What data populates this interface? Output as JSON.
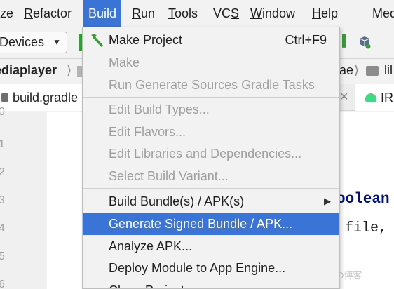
{
  "menubar": {
    "items": [
      {
        "label": "ze"
      },
      {
        "label": "Refactor"
      },
      {
        "label": "Build"
      },
      {
        "label": "Run"
      },
      {
        "label": "Tools"
      },
      {
        "label": "VCS"
      },
      {
        "label": "Window"
      },
      {
        "label": "Help"
      },
      {
        "label": "Med"
      }
    ]
  },
  "toolbar": {
    "devices_label": "Devices"
  },
  "breadcrumb": {
    "left": "ediaplayer",
    "right": "ae",
    "lib": "lil"
  },
  "tabs": {
    "first": "build.gradle",
    "second": "IR"
  },
  "gutter": {
    "line_numbers": [
      "0",
      "1",
      "2",
      "3",
      "4",
      "5",
      "6"
    ]
  },
  "editor": {
    "line1": "oolean",
    "line2": "file,"
  },
  "watermark": "https://blog.csdn.n@51CTO博客",
  "build_menu": {
    "items": [
      {
        "label": "Make Project",
        "shortcut": "Ctrl+F9",
        "enabled": true,
        "icon": "hammer-icon"
      },
      {
        "label": "Make",
        "enabled": false
      },
      {
        "label": "Run Generate Sources Gradle Tasks",
        "enabled": false
      },
      {
        "label": "Edit Build Types...",
        "enabled": false
      },
      {
        "label": "Edit Flavors...",
        "enabled": false
      },
      {
        "label": "Edit Libraries and Dependencies...",
        "enabled": false
      },
      {
        "label": "Select Build Variant...",
        "enabled": false
      },
      {
        "label": "Build Bundle(s) / APK(s)",
        "enabled": true,
        "submenu": true
      },
      {
        "label": "Generate Signed Bundle / APK...",
        "enabled": true,
        "selected": true
      },
      {
        "label": "Analyze APK...",
        "enabled": true
      },
      {
        "label": "Deploy Module to App Engine...",
        "enabled": true
      },
      {
        "label": "Clean Project",
        "enabled": true
      }
    ]
  },
  "colors": {
    "accent": "#3974d6",
    "menu_bg": "#f2f2f2",
    "disabled_text": "#9e9e9e"
  }
}
